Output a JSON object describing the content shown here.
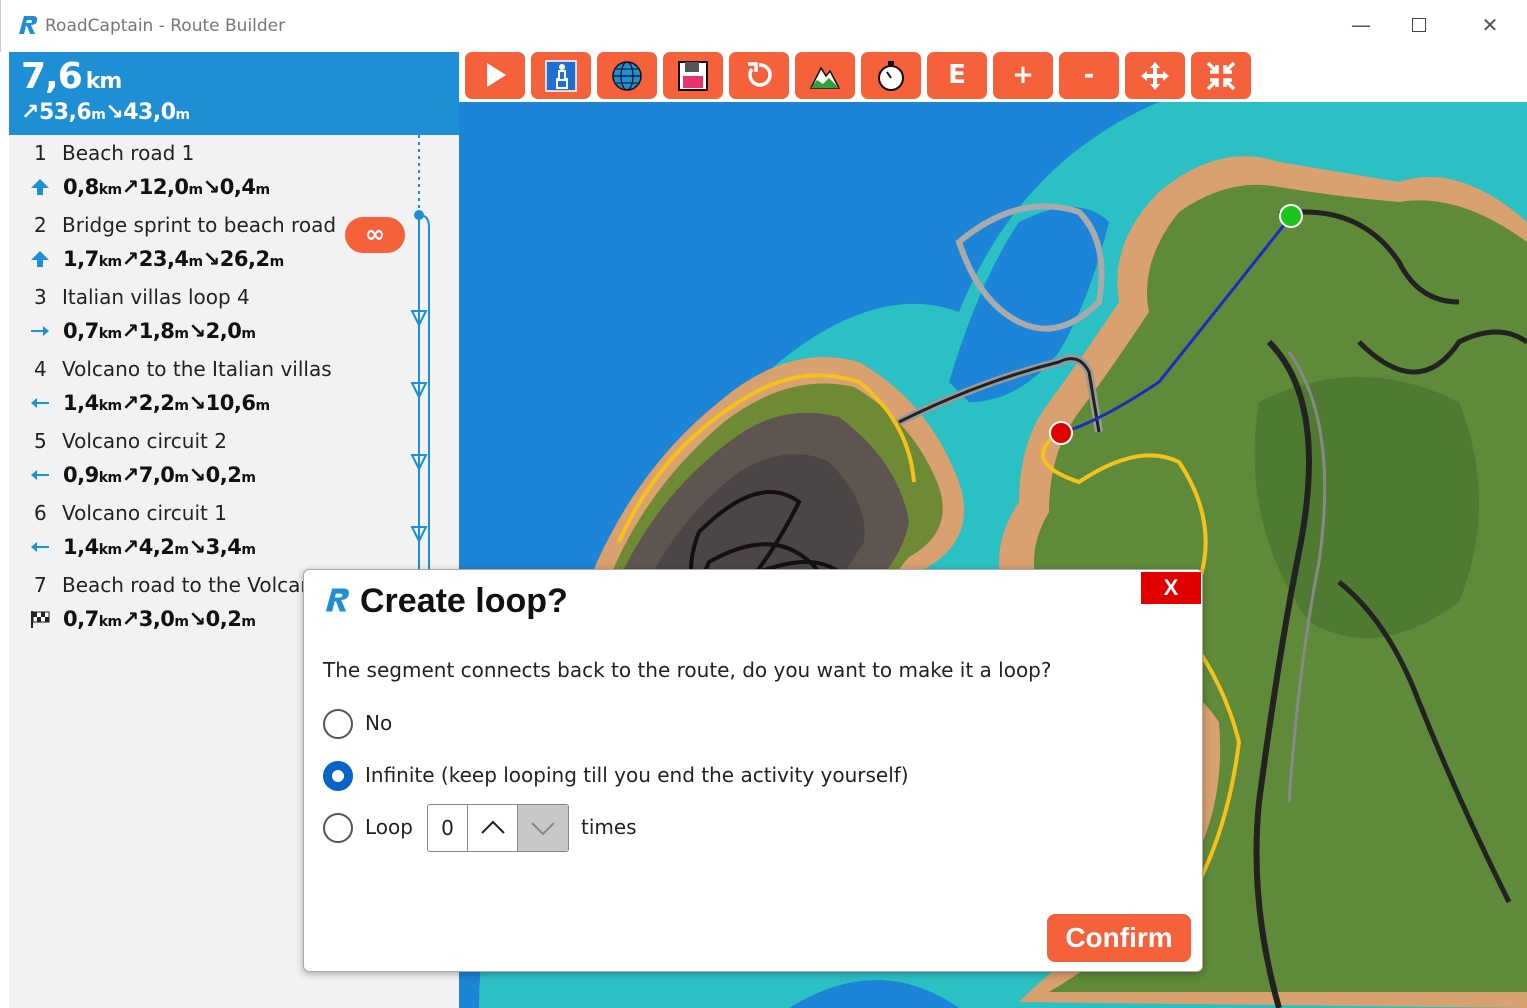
{
  "window": {
    "title": "RoadCaptain - Route Builder",
    "minimize": "—",
    "close": "✕"
  },
  "summary": {
    "distance": "7,6",
    "distance_unit": "km",
    "ascent": "53,6",
    "descent": "43,0",
    "elev_unit": "m"
  },
  "segments": [
    {
      "num": "1",
      "name": "Beach road 1",
      "dist": "0,8",
      "up": "12,0",
      "down": "0,4",
      "dir": "up-arrow-icon"
    },
    {
      "num": "2",
      "name": "Bridge sprint to beach road",
      "dist": "1,7",
      "up": "23,4",
      "down": "26,2",
      "dir": "up-arrow-icon",
      "badge": "∞"
    },
    {
      "num": "3",
      "name": "Italian villas loop 4",
      "dist": "0,7",
      "up": "1,8",
      "down": "2,0",
      "dir": "right-arrow-icon"
    },
    {
      "num": "4",
      "name": "Volcano to the Italian villas",
      "dist": "1,4",
      "up": "2,2",
      "down": "10,6",
      "dir": "left-arrow-icon"
    },
    {
      "num": "5",
      "name": "Volcano circuit 2",
      "dist": "0,9",
      "up": "7,0",
      "down": "0,2",
      "dir": "left-arrow-icon"
    },
    {
      "num": "6",
      "name": "Volcano circuit 1",
      "dist": "1,4",
      "up": "4,2",
      "down": "3,4",
      "dir": "left-arrow-icon"
    },
    {
      "num": "7",
      "name": "Beach road to the Volcano",
      "dist": "0,7",
      "up": "3,0",
      "down": "0,2",
      "dir": "checkered-flag-icon"
    }
  ],
  "units": {
    "km": "km",
    "m": "m",
    "up": "↗",
    "down": "↘"
  },
  "toolbar": {
    "buttons": [
      "play-icon",
      "clear-route-icon",
      "world-icon",
      "save-icon",
      "reset-icon",
      "elevation-icon",
      "stopwatch-icon",
      "E",
      "+",
      "-",
      "move-icon",
      "collapse-icon"
    ],
    "e_label": "E",
    "plus_label": "+",
    "minus_label": "-"
  },
  "dialog": {
    "title": "Create loop?",
    "close_label": "X",
    "message": "The segment connects back to the route, do you want to make it a loop?",
    "options": {
      "no": "No",
      "infinite": "Infinite (keep looping till you end the activity yourself)",
      "loop": "Loop",
      "times": "times"
    },
    "selected": "infinite",
    "loop_count": "0",
    "confirm_label": "Confirm"
  },
  "colors": {
    "accent_orange": "#f5613a",
    "summary_blue": "#1e8fd4",
    "radio_blue": "#0a63c9",
    "close_red": "#e00000",
    "start_marker": "#1ec31e",
    "end_marker": "#e00000"
  }
}
